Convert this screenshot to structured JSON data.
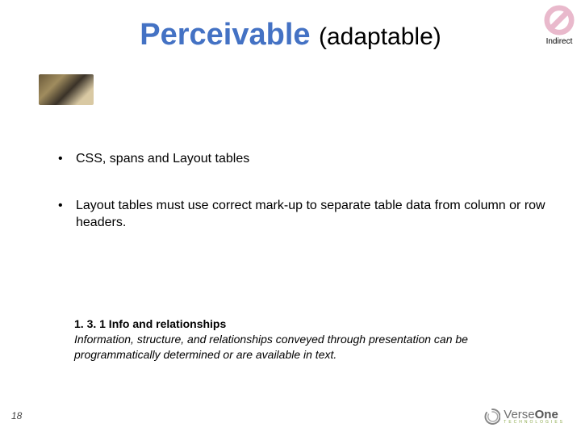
{
  "title": {
    "main": "Perceivable",
    "sub": "(adaptable)"
  },
  "badge": {
    "label": "Indirect"
  },
  "bullets": [
    "CSS, spans and Layout tables",
    "Layout tables must use correct mark-up to separate table data from column or row headers."
  ],
  "footnote": {
    "title": "1. 3. 1 Info and relationships",
    "body": "Information, structure, and relationships conveyed through presentation can be programmatically determined or are available in text."
  },
  "page_number": "18",
  "logo": {
    "brand_a": "Verse",
    "brand_b": "One",
    "sub": "TECHNOLOGIES"
  }
}
